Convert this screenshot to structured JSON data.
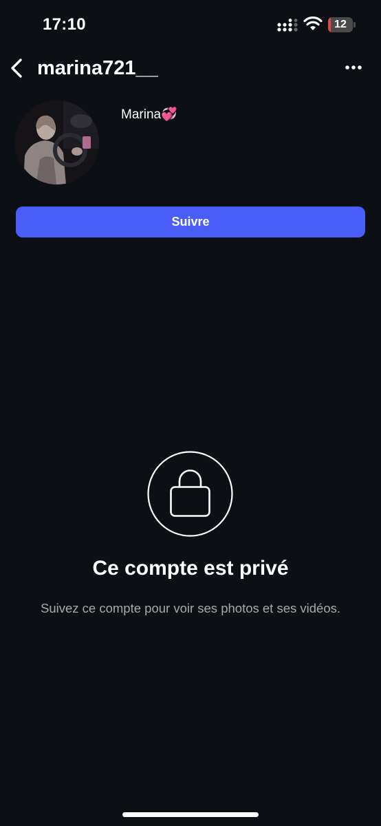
{
  "status_bar": {
    "time": "17:10",
    "battery_level": "12",
    "battery_fraction": 0.12,
    "icons": [
      "signal-icon",
      "wifi-icon",
      "battery-icon"
    ]
  },
  "header": {
    "back_icon": "chevron-left-icon",
    "username": "marina721__",
    "more_icon": "more-horizontal-icon"
  },
  "profile": {
    "display_name": "Marina💞",
    "follow_label": "Suivre"
  },
  "private_notice": {
    "icon": "lock-icon",
    "title": "Ce compte est privé",
    "description": "Suivez ce compte pour voir ses photos et ses vidéos."
  },
  "colors": {
    "background": "#0c1014",
    "accent": "#4a5df9",
    "secondary_text": "#a8a8a8",
    "battery_low": "#e5453c"
  }
}
